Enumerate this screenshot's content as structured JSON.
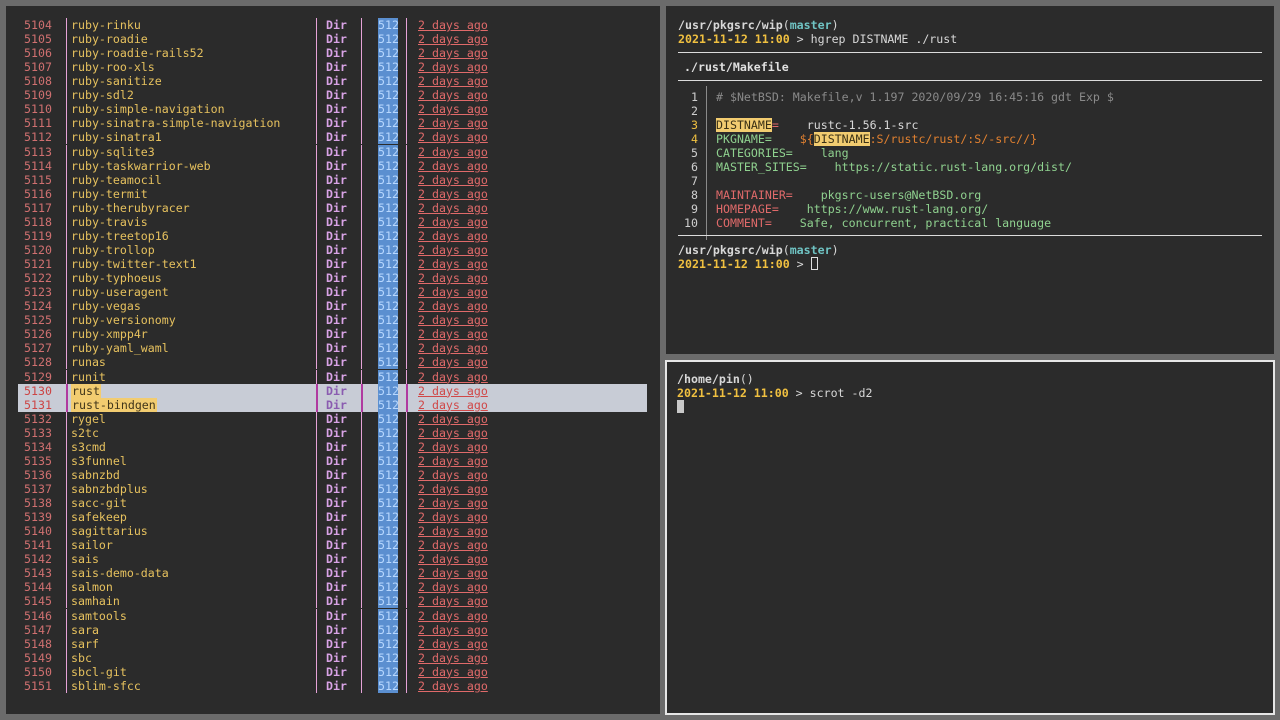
{
  "file_list": {
    "rows": [
      {
        "n": "5104",
        "name": "ruby-rinku"
      },
      {
        "n": "5105",
        "name": "ruby-roadie"
      },
      {
        "n": "5106",
        "name": "ruby-roadie-rails52"
      },
      {
        "n": "5107",
        "name": "ruby-roo-xls"
      },
      {
        "n": "5108",
        "name": "ruby-sanitize"
      },
      {
        "n": "5109",
        "name": "ruby-sdl2"
      },
      {
        "n": "5110",
        "name": "ruby-simple-navigation"
      },
      {
        "n": "5111",
        "name": "ruby-sinatra-simple-navigation"
      },
      {
        "n": "5112",
        "name": "ruby-sinatra1"
      },
      {
        "n": "5113",
        "name": "ruby-sqlite3"
      },
      {
        "n": "5114",
        "name": "ruby-taskwarrior-web"
      },
      {
        "n": "5115",
        "name": "ruby-teamocil"
      },
      {
        "n": "5116",
        "name": "ruby-termit"
      },
      {
        "n": "5117",
        "name": "ruby-therubyracer"
      },
      {
        "n": "5118",
        "name": "ruby-travis"
      },
      {
        "n": "5119",
        "name": "ruby-treetop16"
      },
      {
        "n": "5120",
        "name": "ruby-trollop"
      },
      {
        "n": "5121",
        "name": "ruby-twitter-text1"
      },
      {
        "n": "5122",
        "name": "ruby-typhoeus"
      },
      {
        "n": "5123",
        "name": "ruby-useragent"
      },
      {
        "n": "5124",
        "name": "ruby-vegas"
      },
      {
        "n": "5125",
        "name": "ruby-versionomy"
      },
      {
        "n": "5126",
        "name": "ruby-xmpp4r"
      },
      {
        "n": "5127",
        "name": "ruby-yaml_waml"
      },
      {
        "n": "5128",
        "name": "runas"
      },
      {
        "n": "5129",
        "name": "runit"
      },
      {
        "n": "5130",
        "name": "rust",
        "selected": true
      },
      {
        "n": "5131",
        "name": "rust-bindgen",
        "selected": true
      },
      {
        "n": "5132",
        "name": "rygel"
      },
      {
        "n": "5133",
        "name": "s2tc"
      },
      {
        "n": "5134",
        "name": "s3cmd"
      },
      {
        "n": "5135",
        "name": "s3funnel"
      },
      {
        "n": "5136",
        "name": "sabnzbd"
      },
      {
        "n": "5137",
        "name": "sabnzbdplus"
      },
      {
        "n": "5138",
        "name": "sacc-git"
      },
      {
        "n": "5139",
        "name": "safekeep"
      },
      {
        "n": "5140",
        "name": "sagittarius"
      },
      {
        "n": "5141",
        "name": "sailor"
      },
      {
        "n": "5142",
        "name": "sais"
      },
      {
        "n": "5143",
        "name": "sais-demo-data"
      },
      {
        "n": "5144",
        "name": "salmon"
      },
      {
        "n": "5145",
        "name": "samhain"
      },
      {
        "n": "5146",
        "name": "samtools"
      },
      {
        "n": "5147",
        "name": "sara"
      },
      {
        "n": "5148",
        "name": "sarf"
      },
      {
        "n": "5149",
        "name": "sbc"
      },
      {
        "n": "5150",
        "name": "sbcl-git"
      },
      {
        "n": "5151",
        "name": "sblim-sfcc"
      }
    ],
    "type_label": "Dir",
    "size_label": "512",
    "date_label": "2 days ago"
  },
  "top_terminal": {
    "prompt1": {
      "path_a": "/usr/pkgsrc/wip",
      "paren_open": "(",
      "branch": "master",
      "paren_close": ")",
      "stamp": "2021-11-12 11:00",
      "arrow": " > ",
      "command": "hgrep DISTNAME ./rust"
    },
    "file_header": "./rust/Makefile",
    "lines": [
      {
        "n": "1"
      },
      {
        "n": "2"
      },
      {
        "n": "3"
      },
      {
        "n": "4"
      },
      {
        "n": "5"
      },
      {
        "n": "6"
      },
      {
        "n": "7"
      },
      {
        "n": "8"
      },
      {
        "n": "9"
      },
      {
        "n": "10"
      }
    ],
    "code": {
      "l1": "# $NetBSD: Makefile,v 1.197 2020/09/29 16:45:16 gdt Exp $",
      "l3_key": "DISTNAME",
      "l3_eq": "=",
      "l3_val": "    rustc-1.56.1-src",
      "l4_key": "PKGNAME=",
      "l4_pre": "    ${",
      "l4_hl": "DISTNAME",
      "l4_post": ":S/rustc/rust/:S/-src//}",
      "l5_key": "CATEGORIES=",
      "l5_val": "    lang",
      "l6_key": "MASTER_SITES=",
      "l6_val": "    https://static.rust-lang.org/dist/",
      "l8_key": "MAINTAINER=",
      "l8_val": "    pkgsrc-users@NetBSD.org",
      "l9_key": "HOMEPAGE=",
      "l9_val": "    https://www.rust-lang.org/",
      "l10_key": "COMMENT=",
      "l10_val": "    Safe, concurrent, practical language"
    },
    "prompt2": {
      "path_a": "/usr/pkgsrc/wip",
      "paren_open": "(",
      "branch": "master",
      "paren_close": ")",
      "stamp": "2021-11-12 11:00",
      "arrow": " > "
    }
  },
  "bottom_terminal": {
    "prompt": {
      "path": "/home/pin",
      "parens": "()",
      "stamp": "2021-11-12 11:00",
      "arrow": " > ",
      "command": "scrot -d2"
    }
  }
}
